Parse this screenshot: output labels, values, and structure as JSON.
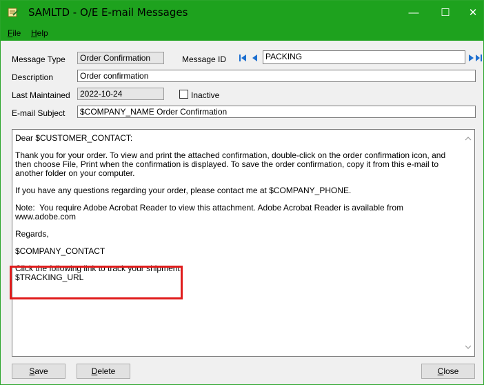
{
  "window": {
    "title": "SAMLTD - O/E E-mail Messages",
    "controls": {
      "minimize": "—",
      "maximize": "☐",
      "close": "✕"
    }
  },
  "menu": [
    {
      "label": "File"
    },
    {
      "label": "Help"
    }
  ],
  "form": {
    "message_type_label": "Message Type",
    "message_type_value": "Order Confirmation",
    "message_id_label": "Message ID",
    "message_id_value": "PACKING",
    "description_label": "Description",
    "description_value": "Order confirmation",
    "last_maintained_label": "Last Maintained",
    "last_maintained_value": "2022-10-24",
    "inactive_label": "Inactive",
    "subject_label": "E-mail Subject",
    "subject_value": "$COMPANY_NAME Order Confirmation"
  },
  "message_body": [
    "Dear $CUSTOMER_CONTACT:",
    "Thank you for your order. To view and print the attached confirmation, double-click on the order confirmation icon, and then choose File, Print when the confirmation is displayed. To save the order confirmation, copy it from this e-mail to another folder on your computer.",
    "If you have any questions regarding your order, please contact me at $COMPANY_PHONE.",
    "Note:  You require Adobe Acrobat Reader to view this attachment. Adobe Acrobat Reader is available from www.adobe.com",
    "Regards,",
    "$COMPANY_CONTACT",
    "Click the following link to track your shipment:\n$TRACKING_URL"
  ],
  "buttons": {
    "save": "Save",
    "delete": "Delete",
    "close": "Close"
  },
  "colors": {
    "titlebar": "#1ea21e",
    "highlight": "#e01c1c",
    "nav": "#1c6fd0",
    "add": "#2aa52a"
  }
}
